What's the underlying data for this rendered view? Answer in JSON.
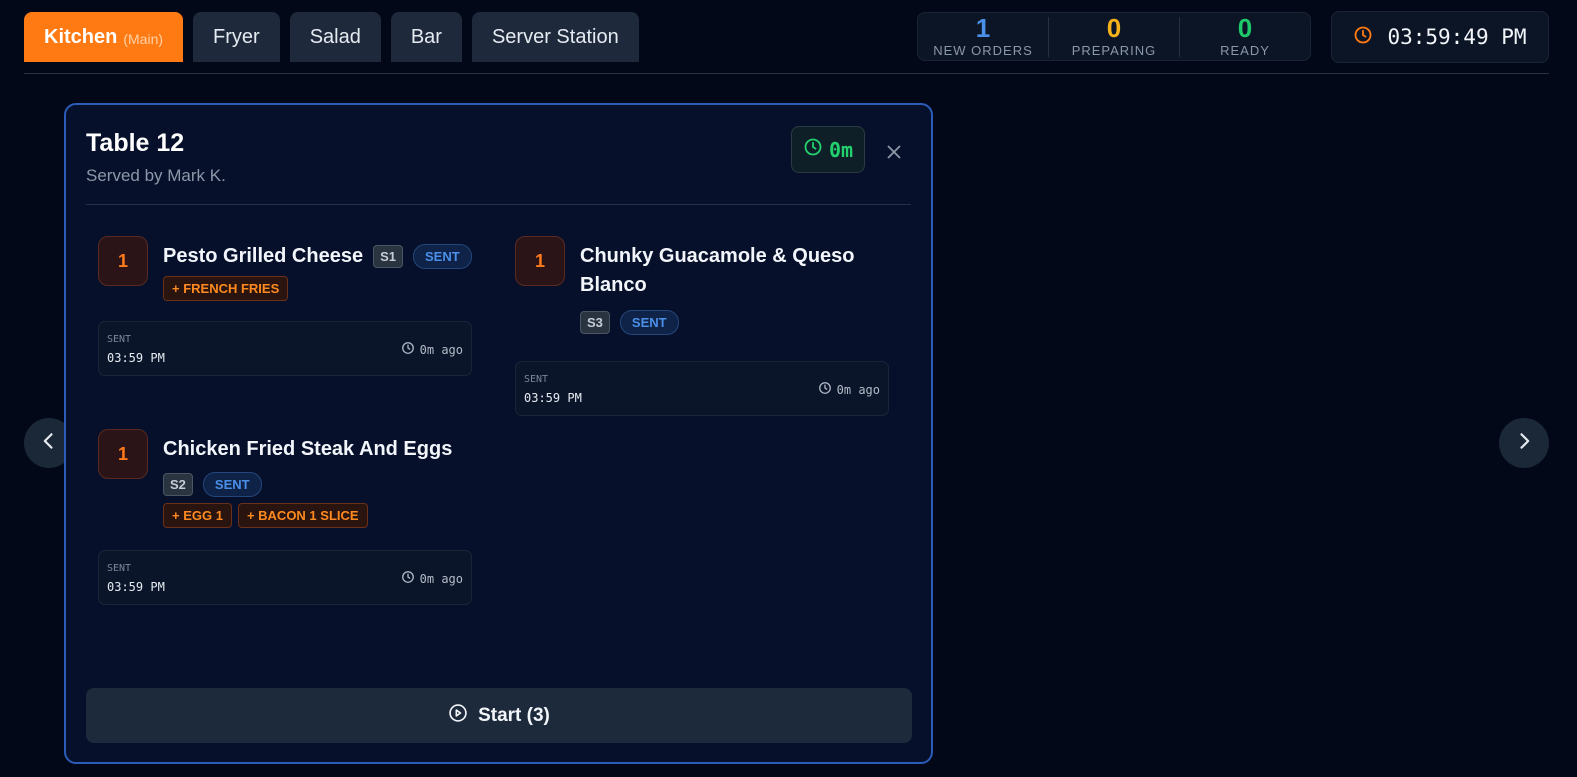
{
  "tabs": [
    {
      "label": "Kitchen",
      "sub": "(Main)"
    },
    {
      "label": "Fryer"
    },
    {
      "label": "Salad"
    },
    {
      "label": "Bar"
    },
    {
      "label": "Server Station"
    }
  ],
  "stats": {
    "new_orders": {
      "value": "1",
      "label": "NEW ORDERS"
    },
    "preparing": {
      "value": "0",
      "label": "PREPARING"
    },
    "ready": {
      "value": "0",
      "label": "READY"
    }
  },
  "clock": "03:59:49 PM",
  "order": {
    "table": "Table 12",
    "served_by": "Served by Mark K.",
    "timer": "0m",
    "items": [
      {
        "qty": "1",
        "name": "Pesto Grilled Cheese",
        "seat": "S1",
        "status": "SENT",
        "modifiers": [
          "+ FRENCH FRIES"
        ],
        "sent_label": "SENT",
        "sent_time": "03:59 PM",
        "ago": "0m ago"
      },
      {
        "qty": "1",
        "name": "Chunky Guacamole & Queso Blanco",
        "seat": "S3",
        "status": "SENT",
        "modifiers": [],
        "sent_label": "SENT",
        "sent_time": "03:59 PM",
        "ago": "0m ago"
      },
      {
        "qty": "1",
        "name": "Chicken Fried Steak And Eggs",
        "seat": "S2",
        "status": "SENT",
        "modifiers": [
          "+ EGG 1",
          "+ BACON 1 SLICE"
        ],
        "sent_label": "SENT",
        "sent_time": "03:59 PM",
        "ago": "0m ago"
      }
    ],
    "start_label": "Start (3)"
  },
  "colors": {
    "accent": "#ff7a12",
    "new": "#4a8fe8",
    "preparing": "#f5b21c",
    "ready": "#1ec86a",
    "card_border": "#2a5cb8"
  }
}
